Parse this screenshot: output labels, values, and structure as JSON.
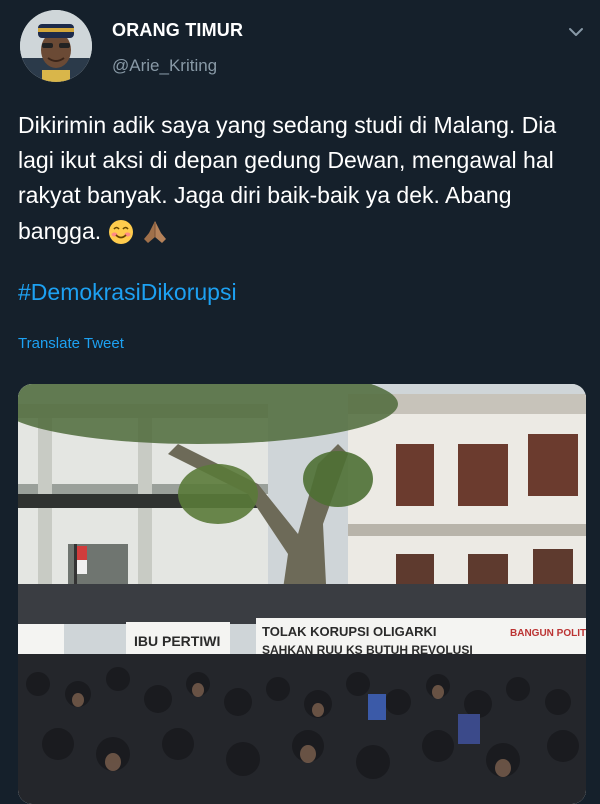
{
  "tweet": {
    "author_name": "ORANG TIMUR",
    "author_handle": "@Arie_Kriting",
    "text": "Dikirimin adik saya yang sedang studi di Malang. Dia lagi ikut aksi di depan gedung Dewan, mengawal hal rakyat banyak. Jaga diri baik-baik ya dek. Abang bangga.",
    "emojis": [
      "smiling-face-with-smiling-eyes",
      "folded-hands"
    ],
    "hashtag": "#DemokrasiDikorupsi",
    "translate_label": "Translate Tweet",
    "menu_icon": "chevron-down-icon"
  },
  "photo": {
    "description_icon": "protest-photo",
    "banners": [
      "IBU PERTIWI",
      "TOLAK KORUPSI OLIGARKI",
      "SAHKAN RUU KS BUTUH REVOLUSI",
      "BANGUN POLITIK ALTERNATIF"
    ]
  },
  "colors": {
    "background": "#15202b",
    "accent": "#1da1f2",
    "secondary_text": "#8899a6"
  }
}
